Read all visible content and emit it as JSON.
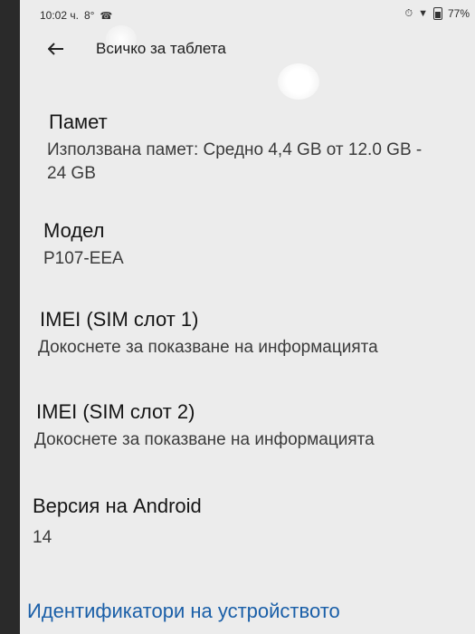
{
  "status_bar": {
    "time": "10:02 ч.",
    "temperature": "8°",
    "battery": "77%",
    "icons": [
      "viber-icon",
      "alarm-icon",
      "wifi-icon",
      "battery-icon"
    ]
  },
  "app_bar": {
    "back_icon": "arrow-left-icon",
    "title": "Всичко за таблета"
  },
  "items": [
    {
      "title": "Памет",
      "subtitle_line1": "Използвана памет: Средно 4,4 GB от 12.0 GB -",
      "subtitle_line2": "24 GB"
    },
    {
      "title": "Модел",
      "subtitle": "P107-EEA"
    },
    {
      "title": "IMEI (SIM слот 1)",
      "subtitle": "Докоснете за показване на информацията"
    },
    {
      "title": "IMEI (SIM слот 2)",
      "subtitle": "Докоснете за показване на информацията"
    },
    {
      "title": "Версия на Android",
      "subtitle": "14"
    }
  ],
  "section_header": "Идентификатори на устройството",
  "colors": {
    "accent": "#1a5fa8",
    "background": "#ececec"
  }
}
